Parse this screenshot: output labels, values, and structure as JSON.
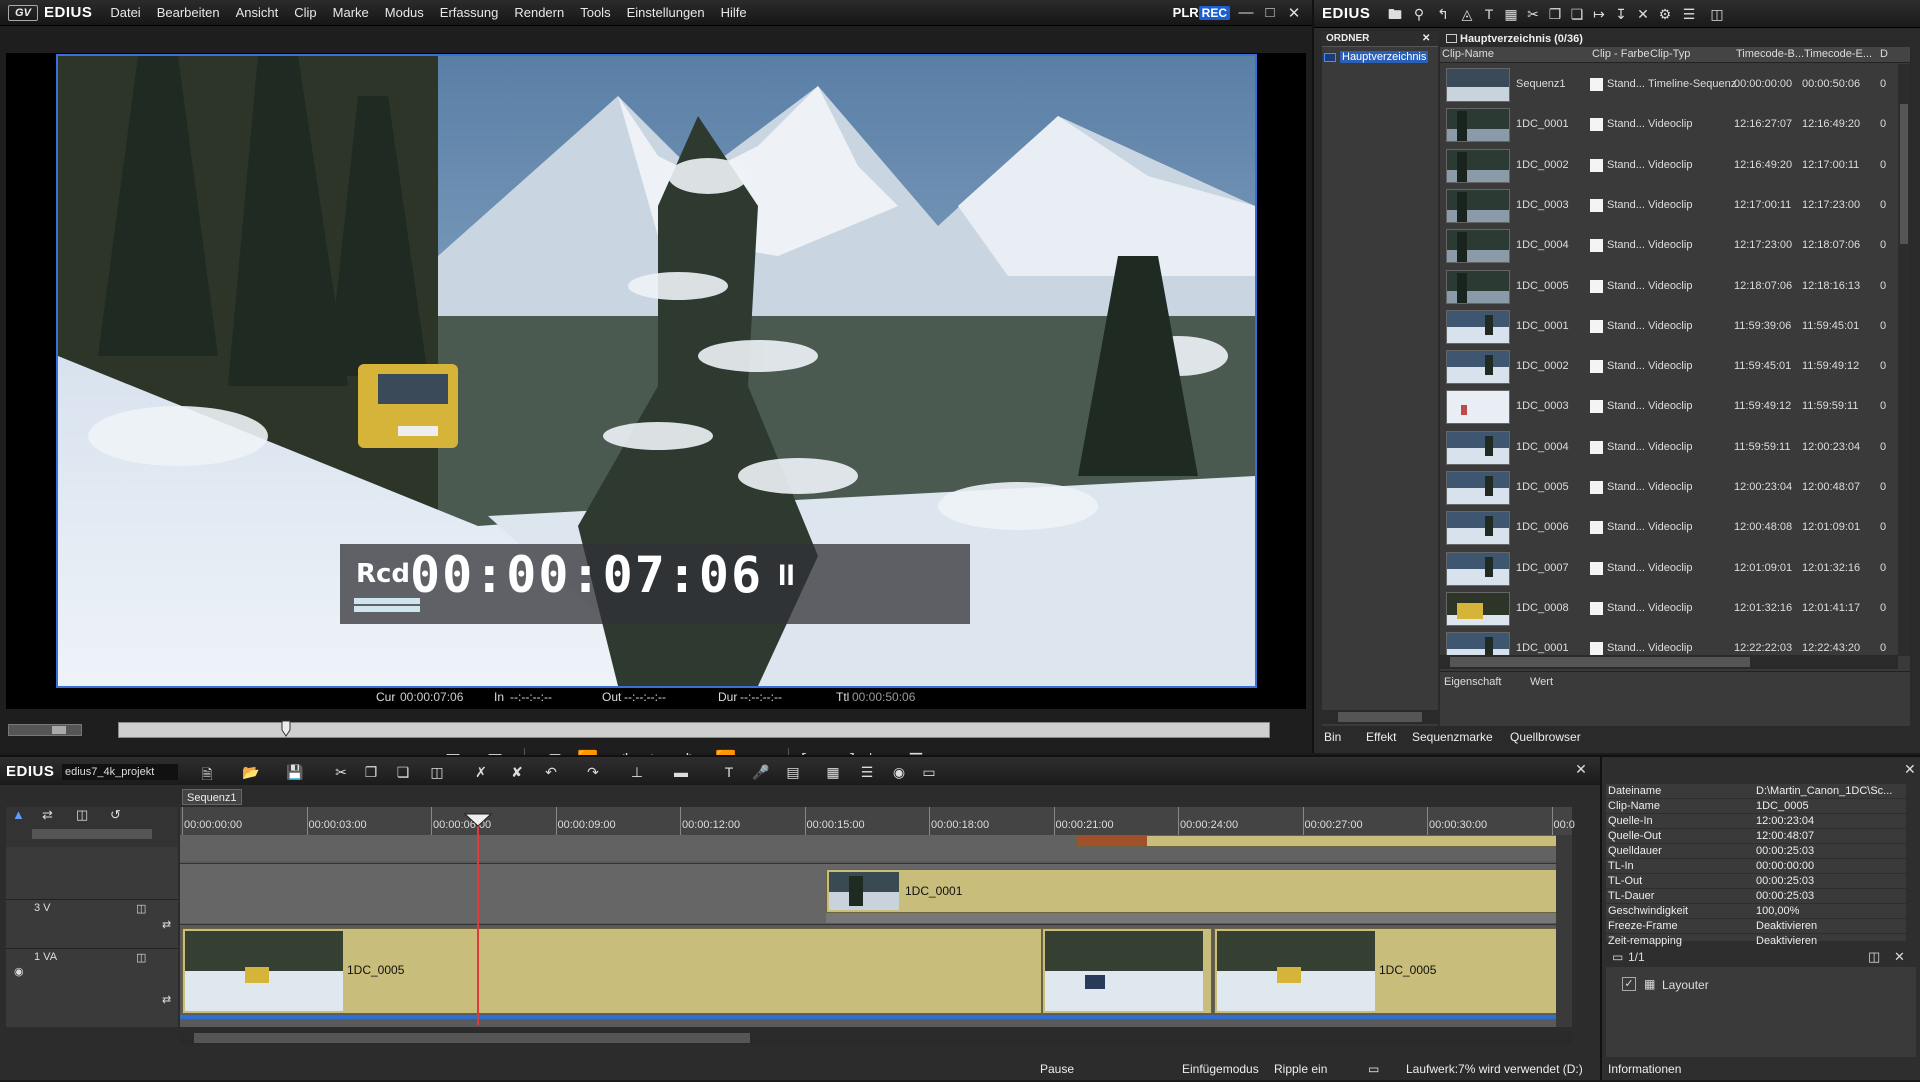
{
  "menubar": {
    "logo_text": "EDIUS",
    "logo_box": "GV",
    "items": [
      "Datei",
      "Bearbeiten",
      "Ansicht",
      "Clip",
      "Marke",
      "Modus",
      "Erfassung",
      "Rendern",
      "Tools",
      "Einstellungen",
      "Hilfe"
    ],
    "plr": "PLR",
    "rec": "REC"
  },
  "player": {
    "timecode_label": "Rcd",
    "timecode": "00:00:07:06",
    "pause_glyph": "II",
    "cur_label": "Cur",
    "cur_value": "00:00:07:06",
    "in_label": "In",
    "in_value": "--:--:--:--",
    "out_label": "Out",
    "out_value": "--:--:--:--",
    "dur_label": "Dur",
    "dur_value": "--:--:--:--",
    "ttl_label": "Ttl",
    "ttl_value": "00:00:50:06",
    "scrub_position": 0.146
  },
  "bin": {
    "logo_text": "EDIUS",
    "folder_header": "ORDNER",
    "folder_item": "Hauptverzeichnis",
    "clip_header": "Hauptverzeichnis (0/36)",
    "columns": [
      "Clip-Name",
      "Clip - Farbe",
      "Clip-Typ",
      "Timecode-B...",
      "Timecode-E...",
      "D"
    ],
    "rows": [
      {
        "name": "Sequenz1",
        "color": "Stand...",
        "type": "Timeline-Sequenz",
        "tc_in": "00:00:00:00",
        "tc_out": "00:00:50:06",
        "d": "0",
        "thumb": "seq"
      },
      {
        "name": "1DC_0001",
        "color": "Stand...",
        "type": "Videoclip",
        "tc_in": "12:16:27:07",
        "tc_out": "12:16:49:20",
        "d": "0",
        "thumb": "forest"
      },
      {
        "name": "1DC_0002",
        "color": "Stand...",
        "type": "Videoclip",
        "tc_in": "12:16:49:20",
        "tc_out": "12:17:00:11",
        "d": "0",
        "thumb": "forest"
      },
      {
        "name": "1DC_0003",
        "color": "Stand...",
        "type": "Videoclip",
        "tc_in": "12:17:00:11",
        "tc_out": "12:17:23:00",
        "d": "0",
        "thumb": "forest"
      },
      {
        "name": "1DC_0004",
        "color": "Stand...",
        "type": "Videoclip",
        "tc_in": "12:17:23:00",
        "tc_out": "12:18:07:06",
        "d": "0",
        "thumb": "forest"
      },
      {
        "name": "1DC_0005",
        "color": "Stand...",
        "type": "Videoclip",
        "tc_in": "12:18:07:06",
        "tc_out": "12:18:16:13",
        "d": "0",
        "thumb": "forest"
      },
      {
        "name": "1DC_0001",
        "color": "Stand...",
        "type": "Videoclip",
        "tc_in": "11:59:39:06",
        "tc_out": "11:59:45:01",
        "d": "0",
        "thumb": "snow"
      },
      {
        "name": "1DC_0002",
        "color": "Stand...",
        "type": "Videoclip",
        "tc_in": "11:59:45:01",
        "tc_out": "11:59:49:12",
        "d": "0",
        "thumb": "snow"
      },
      {
        "name": "1DC_0003",
        "color": "Stand...",
        "type": "Videoclip",
        "tc_in": "11:59:49:12",
        "tc_out": "11:59:59:11",
        "d": "0",
        "thumb": "white"
      },
      {
        "name": "1DC_0004",
        "color": "Stand...",
        "type": "Videoclip",
        "tc_in": "11:59:59:11",
        "tc_out": "12:00:23:04",
        "d": "0",
        "thumb": "snow"
      },
      {
        "name": "1DC_0005",
        "color": "Stand...",
        "type": "Videoclip",
        "tc_in": "12:00:23:04",
        "tc_out": "12:00:48:07",
        "d": "0",
        "thumb": "snow"
      },
      {
        "name": "1DC_0006",
        "color": "Stand...",
        "type": "Videoclip",
        "tc_in": "12:00:48:08",
        "tc_out": "12:01:09:01",
        "d": "0",
        "thumb": "snow"
      },
      {
        "name": "1DC_0007",
        "color": "Stand...",
        "type": "Videoclip",
        "tc_in": "12:01:09:01",
        "tc_out": "12:01:32:16",
        "d": "0",
        "thumb": "snow"
      },
      {
        "name": "1DC_0008",
        "color": "Stand...",
        "type": "Videoclip",
        "tc_in": "12:01:32:16",
        "tc_out": "12:01:41:17",
        "d": "0",
        "thumb": "van"
      },
      {
        "name": "1DC_0001",
        "color": "Stand...",
        "type": "Videoclip",
        "tc_in": "12:22:22:03",
        "tc_out": "12:22:43:20",
        "d": "0",
        "thumb": "snow"
      }
    ],
    "prop_col1": "Eigenschaft",
    "prop_col2": "Wert",
    "tabs": [
      "Bin",
      "Effekt",
      "Sequenzmarke",
      "Quellbrowser"
    ]
  },
  "timeline": {
    "logo_text": "EDIUS",
    "project_name": "edius7_4k_projekt",
    "sequence_tab": "Sequenz1",
    "ruler_labels": [
      "00:00:00:00",
      "00:00:03:00",
      "00:00:06:00",
      "00:00:09:00",
      "00:00:12:00",
      "00:00:15:00",
      "00:00:18:00",
      "00:00:21:00",
      "00:00:24:00",
      "00:00:27:00",
      "00:00:30:00",
      "00:0"
    ],
    "track_3v": "3 V",
    "track_1va": "1 VA",
    "clip_3v": "1DC_0001",
    "clip_1va_a": "1DC_0005",
    "clip_1va_b": "1DC_0005",
    "playhead_time": "00:00:07:06"
  },
  "status": {
    "pause": "Pause",
    "mode": "Einfügemodus",
    "ripple": "Ripple ein",
    "drive": "Laufwerk:7% wird verwendet (D:)"
  },
  "info": {
    "rows": [
      {
        "k": "Dateiname",
        "v": "D:\\Martin_Canon_1DC\\Sc..."
      },
      {
        "k": "Clip-Name",
        "v": "1DC_0005"
      },
      {
        "k": "Quelle-In",
        "v": "12:00:23:04"
      },
      {
        "k": "Quelle-Out",
        "v": "12:00:48:07"
      },
      {
        "k": "Quelldauer",
        "v": "00:00:25:03"
      },
      {
        "k": "TL-In",
        "v": "00:00:00:00"
      },
      {
        "k": "TL-Out",
        "v": "00:00:25:03"
      },
      {
        "k": "TL-Dauer",
        "v": "00:00:25:03"
      },
      {
        "k": "Geschwindigkeit",
        "v": "100,00%"
      },
      {
        "k": "Freeze-Frame",
        "v": "Deaktivieren"
      },
      {
        "k": "Zeit-remapping",
        "v": "Deaktivieren"
      }
    ],
    "layer_count": "1/1",
    "layouter": "Layouter",
    "tab": "Informationen"
  },
  "colors": {
    "accent": "#3a6fd8",
    "clip": "#c8bd7a",
    "playhead": "#e23a3a",
    "rec": "#1c5fcf"
  }
}
